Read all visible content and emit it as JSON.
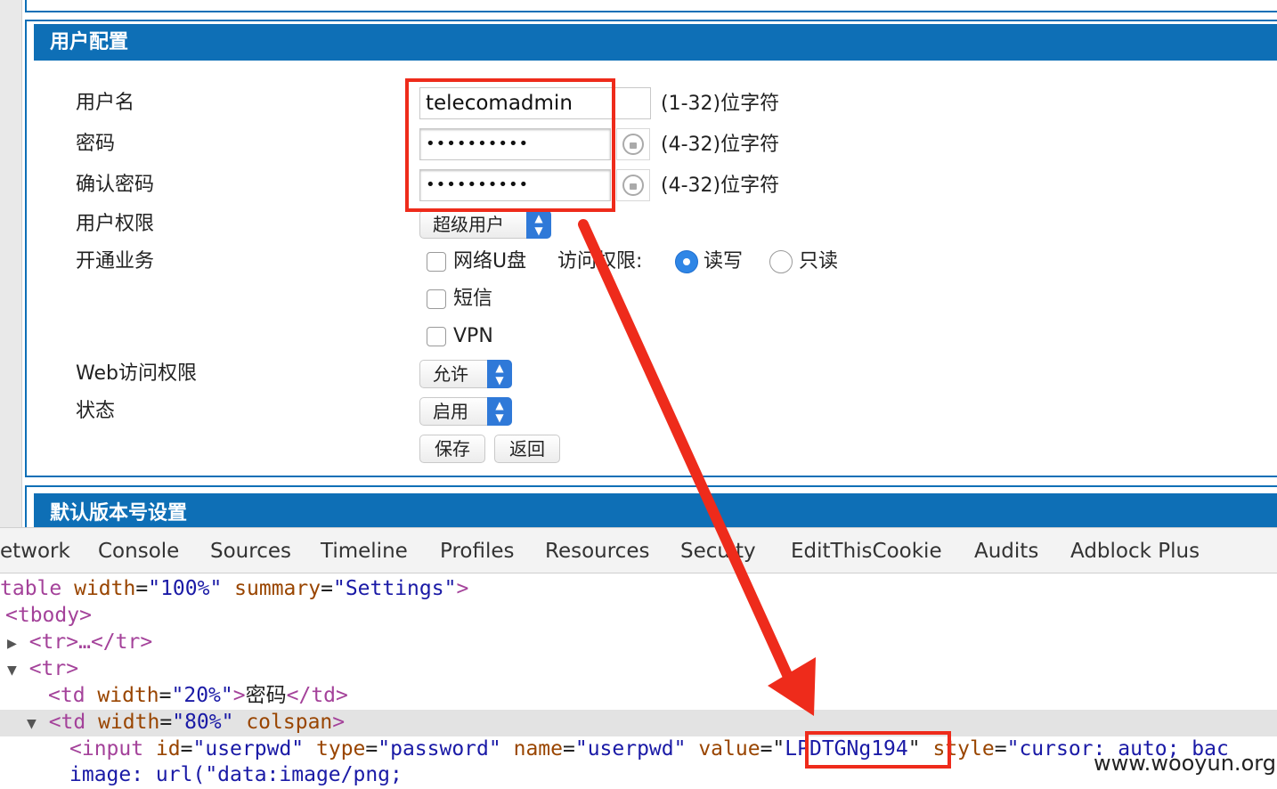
{
  "form": {
    "title": "用户配置",
    "username_label": "用户名",
    "username_value": "telecomadmin",
    "username_hint": "(1-32)位字符",
    "password_label": "密码",
    "password_value": "••••••••••",
    "password_hint": "(4-32)位字符",
    "confirm_label": "确认密码",
    "confirm_value": "••••••••••",
    "confirm_hint": "(4-32)位字符",
    "privilege_label": "用户权限",
    "privilege_value": "超级用户",
    "services_label": "开通业务",
    "service_netdisk": "网络U盘",
    "access_label": "访问权限:",
    "access_rw": "读写",
    "access_ro": "只读",
    "service_sms": "短信",
    "service_vpn": "VPN",
    "web_access_label": "Web访问权限",
    "web_access_value": "允许",
    "status_label": "状态",
    "status_value": "启用",
    "save_label": "保存",
    "back_label": "返回",
    "section2_title": "默认版本号设置"
  },
  "devtools": {
    "tabs": [
      "etwork",
      "Console",
      "Sources",
      "Timeline",
      "Profiles",
      "Resources",
      "Secu",
      "ty",
      "EditThisCookie",
      "Audits",
      "Adblock Plus"
    ],
    "line1": {
      "tag_open": "table",
      "attr1": "width",
      "val1": "\"100%\"",
      "attr2": "summary",
      "val2": "\"Settings\"",
      "close": ">"
    },
    "line2": "<tbody>",
    "line3": "<tr>…</tr>",
    "line4": "<tr>",
    "line5": {
      "open": "<td",
      "attr": "width",
      "val": "\"20%\"",
      "text": "密码",
      "close": "</td>"
    },
    "line6": {
      "open": "<td",
      "attr1": "width",
      "val1": "\"80%\"",
      "attr2": "colspan",
      "close": ">"
    },
    "line7": {
      "open": "<input",
      "a1": "id",
      "v1": "\"userpwd\"",
      "a2": "type",
      "v2": "\"password\"",
      "a3": "name",
      "v3": "\"userpwd\"",
      "a4": "value",
      "v4": "LPDTGNg194",
      "a5": "style",
      "v5": "\"cursor: auto; bac"
    },
    "line8": "image: url(\"data:image/png;"
  },
  "watermark": "www.wooyun.org",
  "colors": {
    "header_blue": "#0e6fb6",
    "annotation_red": "#ee2b1b"
  }
}
